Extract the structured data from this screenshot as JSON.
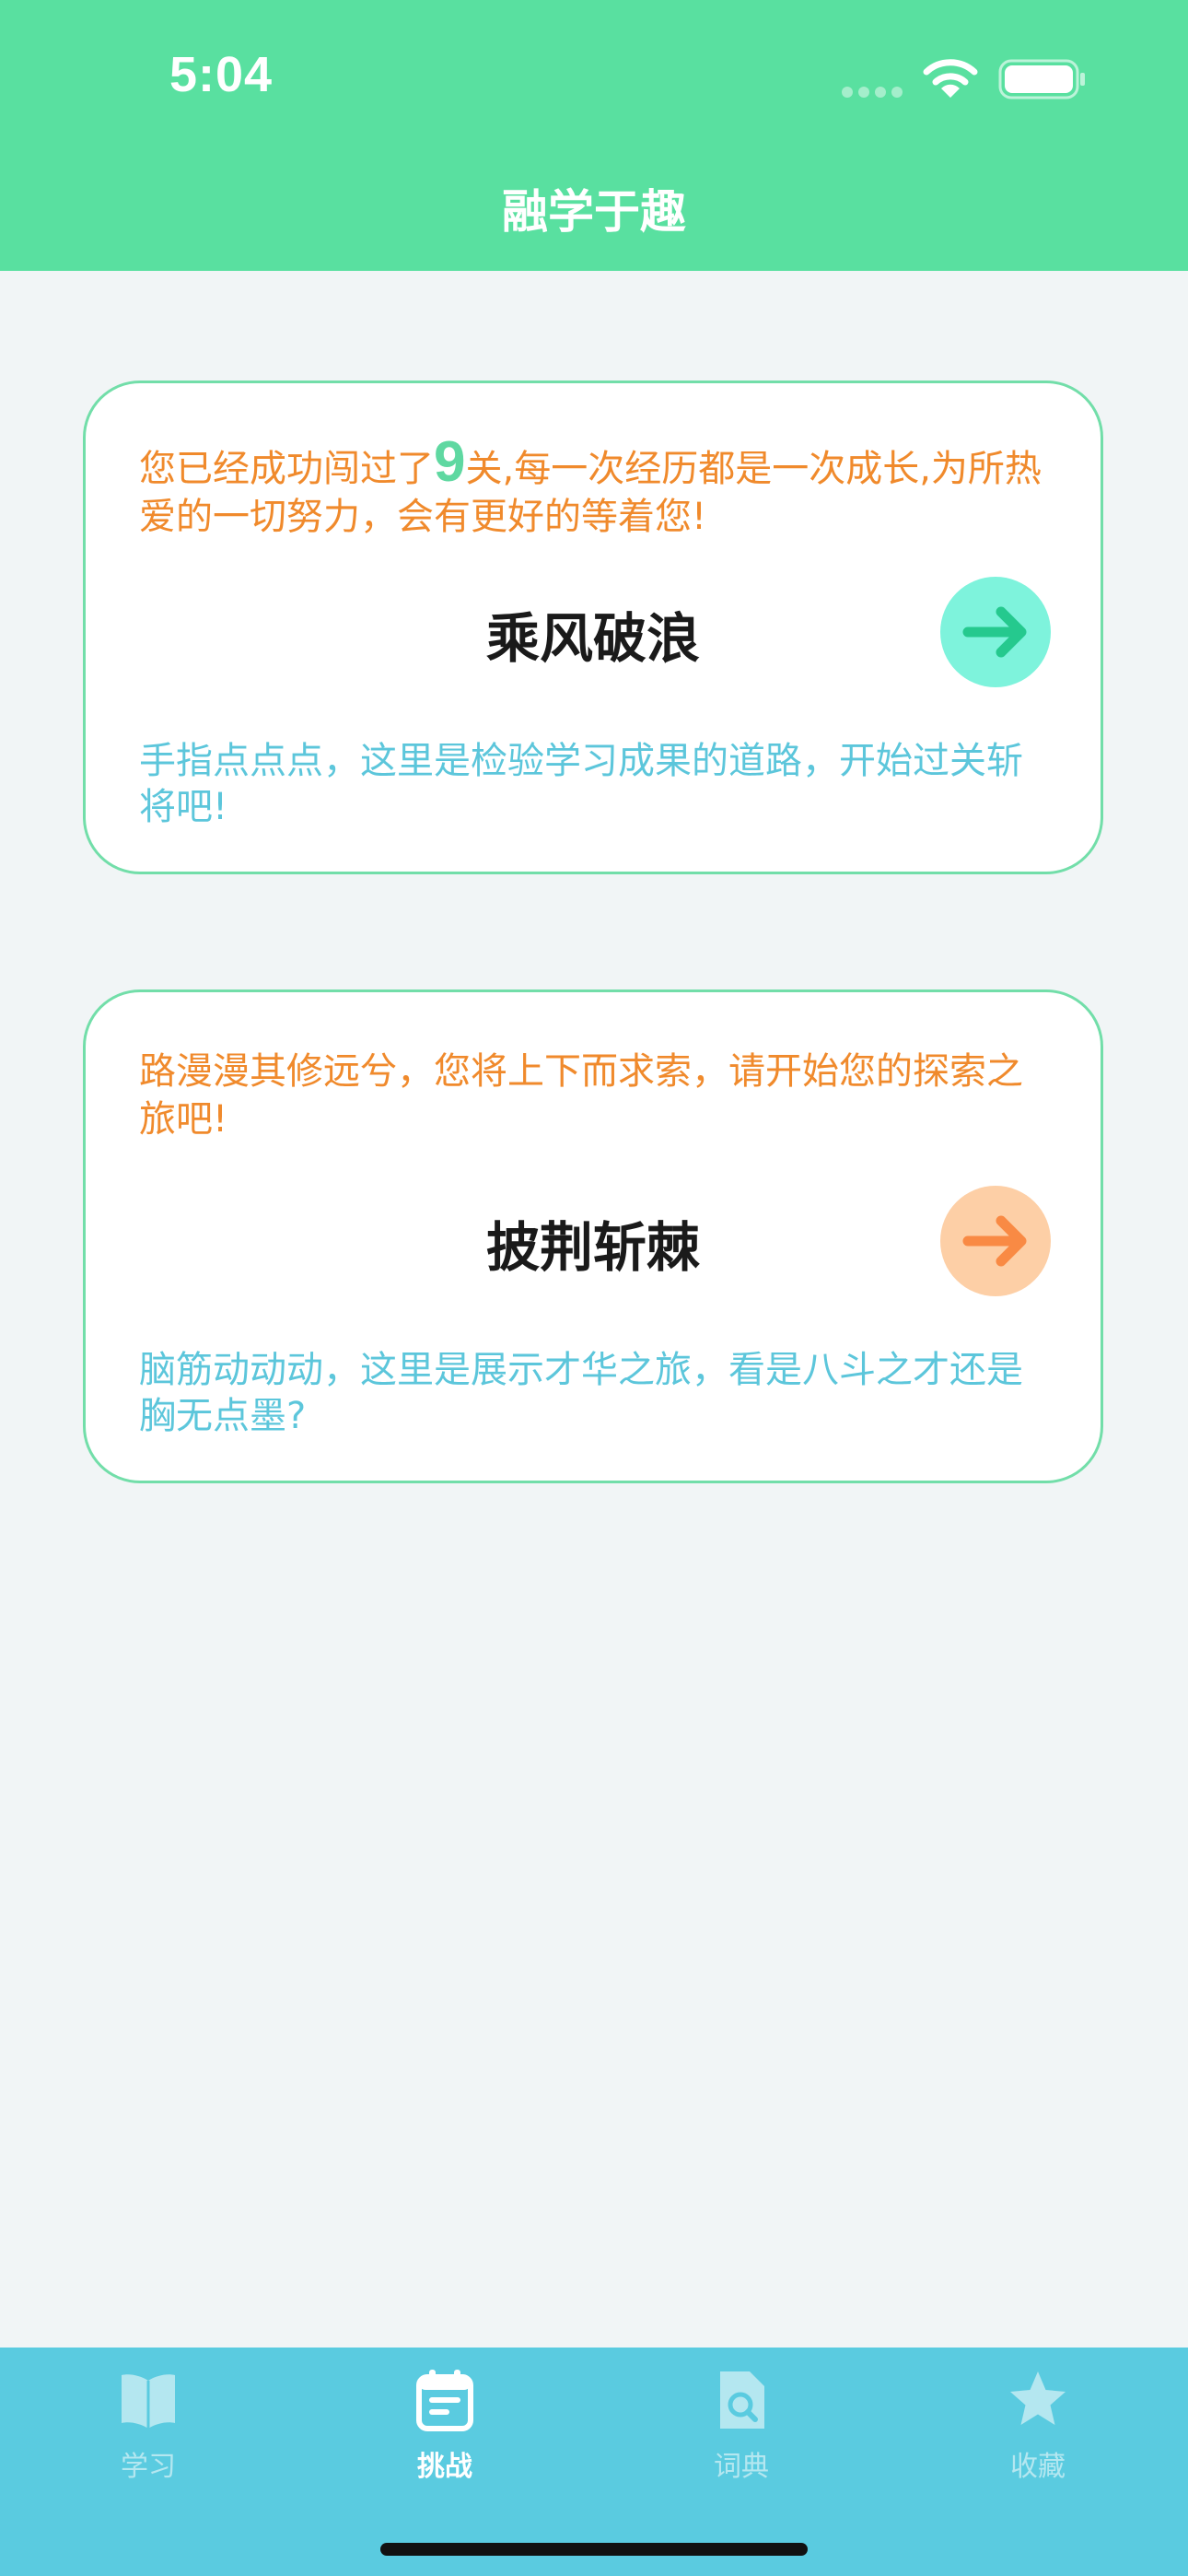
{
  "status_bar": {
    "time": "5:04"
  },
  "header": {
    "title": "融学于趣"
  },
  "cards": [
    {
      "top_text_before": "您已经成功闯过了",
      "level_count": "9",
      "top_text_after": "关,每一次经历都是一次成长,为所热爱的一切努力，会有更好的等着您!",
      "title": "乘风破浪",
      "bottom_text": "手指点点点，这里是检验学习成果的道路，开始过关斩将吧!",
      "button_color": "#7ef3dc",
      "arrow_color": "#25c98e"
    },
    {
      "top_text": "路漫漫其修远兮，您将上下而求索，请开始您的探索之旅吧!",
      "title": "披荆斩棘",
      "bottom_text": "脑筋动动动，这里是展示才华之旅，看是八斗之才还是胸无点墨?",
      "button_color": "#fdcfa6",
      "arrow_color": "#f98a44"
    }
  ],
  "tabbar": {
    "items": [
      {
        "label": "学习",
        "icon": "book-icon",
        "active": false
      },
      {
        "label": "挑战",
        "icon": "calendar-icon",
        "active": true
      },
      {
        "label": "词典",
        "icon": "document-search-icon",
        "active": false
      },
      {
        "label": "收藏",
        "icon": "star-icon",
        "active": false
      }
    ]
  },
  "colors": {
    "header_bg": "#59e0a0",
    "tabbar_bg": "#5acbe0",
    "card_border": "#72dea9",
    "orange_text": "#f08a2c",
    "blue_text": "#5cc6db"
  }
}
